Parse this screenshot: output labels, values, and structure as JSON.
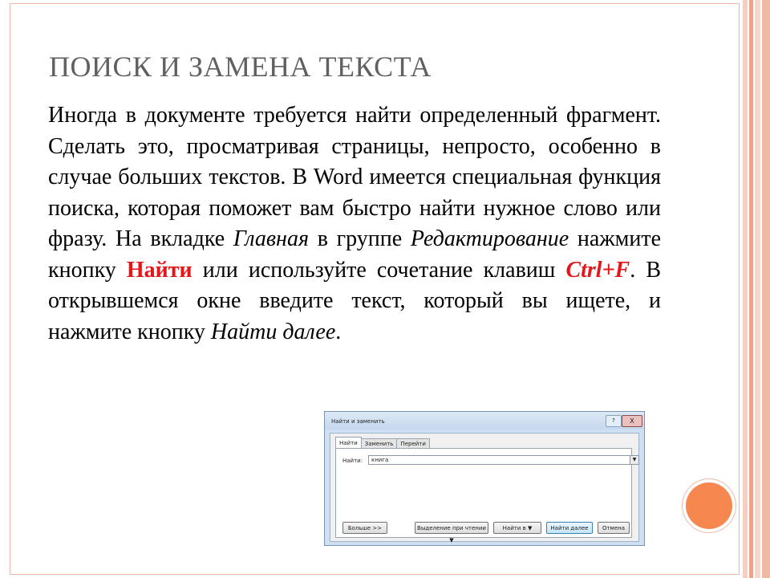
{
  "slide": {
    "title": "ПОИСК И ЗАМЕНА ТЕКСТА",
    "body": {
      "p1": "Иногда в документе требуется найти определенный фрагмент. Сделать это, просматривая страницы, непросто, особенно в случае больших текстов. В Word имеется специальная функция поиска, которая поможет вам быстро найти нужное слово или фразу. На вкладке ",
      "glavnaya": "Главная",
      "p2": " в группе ",
      "redaktirovanie": "Редактирование",
      "p3": " нажмите кнопку ",
      "naiti": "Найти",
      "p4": " или используйте сочетание клавиш ",
      "ctrlf": "Ctrl+F",
      "p5": ". В открывшемся окне введите текст, который вы ищете, и нажмите кнопку ",
      "naiti_dalee": "Найти далее",
      "p6": "."
    }
  },
  "dialog": {
    "title": "Найти и заменить",
    "help": "?",
    "close": "X",
    "tabs": [
      "Найти",
      "Заменить",
      "Перейти"
    ],
    "find_label": "Найти:",
    "find_value": "книга",
    "dropdown_arrow": "▼",
    "buttons": {
      "more": "Больше >>",
      "reading_highlight": "Выделение при чтении ▼",
      "find_in": "Найти в ▼",
      "find_next": "Найти далее",
      "cancel": "Отмена"
    }
  },
  "colors": {
    "title": "#606060",
    "accent_red": "#e5161a",
    "border": "#e9b7a6",
    "orb": "#f5874f"
  }
}
